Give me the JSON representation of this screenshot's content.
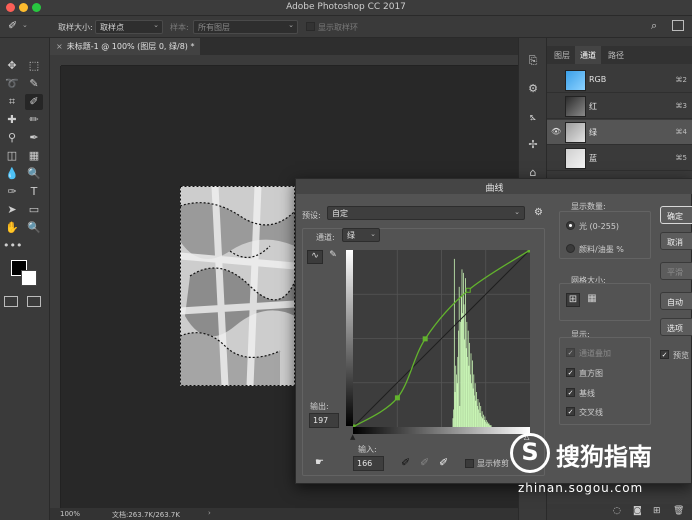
{
  "app": {
    "title": "Adobe Photoshop CC 2017"
  },
  "options_bar": {
    "sample_size_label": "取样大小:",
    "sample_size_value": "取样点",
    "sample_label": "样本:",
    "sample_value": "所有图层",
    "show_ring_label": "显示取样环"
  },
  "document": {
    "tab_title": "未标题-1 @ 100% (图层 0, 绿/8) *",
    "zoom": "100%",
    "doc_info": "文档:263.7K/263.7K"
  },
  "channels_panel": {
    "tabs": [
      "图层",
      "通道",
      "路径"
    ],
    "active_tab": "通道",
    "channels": [
      {
        "name": "RGB",
        "shortcut": "⌘2",
        "selected": false,
        "visible": false
      },
      {
        "name": "红",
        "shortcut": "⌘3",
        "selected": false,
        "visible": false
      },
      {
        "name": "绿",
        "shortcut": "⌘4",
        "selected": true,
        "visible": true
      },
      {
        "name": "蓝",
        "shortcut": "⌘5",
        "selected": false,
        "visible": false
      }
    ]
  },
  "curves": {
    "title": "曲线",
    "preset_label": "预设:",
    "preset_value": "自定",
    "channel_label": "通道:",
    "channel_value": "绿",
    "output_label": "输出:",
    "output_value": "197",
    "input_label": "输入:",
    "input_value": "166",
    "show_clipping_label": "显示修剪",
    "display_amount_label": "显示数量:",
    "light_label": "光 (0-255)",
    "pigment_label": "颜料/油墨 %",
    "light_selected": true,
    "grid_size_label": "网格大小:",
    "show_label": "显示:",
    "show_options": [
      {
        "label": "通道叠加",
        "checked": true,
        "disabled": true
      },
      {
        "label": "直方图",
        "checked": true,
        "disabled": false
      },
      {
        "label": "基线",
        "checked": true,
        "disabled": false
      },
      {
        "label": "交叉线",
        "checked": true,
        "disabled": false
      }
    ],
    "buttons": {
      "ok": "确定",
      "cancel": "取消",
      "smooth": "平滑",
      "auto": "自动",
      "options": "选项"
    },
    "preview_label": "预览",
    "preview_checked": true
  },
  "curve_points": [
    [
      0,
      0
    ],
    [
      64,
      42
    ],
    [
      104,
      127
    ],
    [
      166,
      197
    ],
    [
      255,
      255
    ]
  ],
  "histogram": [
    0,
    0,
    0,
    0,
    0,
    0,
    0,
    0,
    0,
    0,
    0,
    0,
    0,
    0,
    0,
    0,
    0,
    0,
    0,
    0,
    0,
    0,
    0,
    0,
    0,
    0,
    0,
    0,
    0,
    0,
    0,
    0,
    0,
    0,
    0,
    0,
    0,
    0,
    0,
    0,
    0,
    0,
    0,
    0,
    0,
    0,
    0,
    0,
    0,
    0,
    0,
    0,
    0,
    0,
    0,
    0,
    0,
    0,
    0,
    0,
    0,
    0,
    0,
    0,
    0,
    0,
    0,
    0,
    0,
    0,
    0,
    0,
    0,
    0,
    0,
    0,
    0,
    0,
    0,
    0,
    0,
    0,
    0,
    0,
    0,
    0,
    0,
    0,
    0,
    0,
    0,
    0,
    0,
    0,
    0,
    0,
    0,
    0,
    0,
    0,
    0,
    0,
    0,
    0,
    0,
    0,
    0,
    0,
    0,
    0,
    0,
    0,
    0,
    0,
    0,
    0,
    0,
    0,
    0,
    0,
    0,
    0,
    0,
    0,
    0,
    0,
    0,
    0,
    0,
    0,
    0,
    0,
    0,
    0,
    0,
    0,
    0,
    0,
    0,
    0,
    0,
    0,
    0,
    0,
    5,
    10,
    96,
    20,
    35,
    30,
    25,
    40,
    55,
    80,
    12,
    60,
    75,
    90,
    65,
    88,
    70,
    50,
    85,
    45,
    60,
    40,
    55,
    35,
    48,
    30,
    42,
    25,
    38,
    22,
    30,
    18,
    25,
    15,
    20,
    12,
    16,
    10,
    14,
    8,
    12,
    6,
    9,
    5,
    7,
    4,
    6,
    3,
    4,
    2,
    3,
    2,
    2,
    1,
    1,
    1,
    0,
    0,
    0,
    0,
    0,
    0,
    0,
    0,
    0,
    0,
    0,
    0,
    0,
    0,
    0,
    0,
    0,
    0,
    0,
    0,
    0,
    0,
    0,
    0,
    0,
    0,
    0,
    0,
    0,
    0,
    0,
    0,
    0,
    0,
    0,
    0,
    0,
    0,
    0,
    0,
    0,
    0,
    0,
    0,
    0,
    0,
    0,
    0,
    0,
    0,
    0,
    0,
    0,
    0,
    0,
    0,
    0,
    0,
    0,
    0,
    0,
    0,
    0,
    0,
    0,
    0,
    0,
    0,
    0,
    0,
    0,
    0,
    0,
    0,
    0,
    0,
    0,
    0
  ],
  "watermark": {
    "brand": "搜狗指南",
    "url": "zhinan.sogou.com"
  },
  "colors": {
    "curve": "#62b32d",
    "histogram": "#c9f5b5",
    "accent": "#4aa3ff"
  }
}
